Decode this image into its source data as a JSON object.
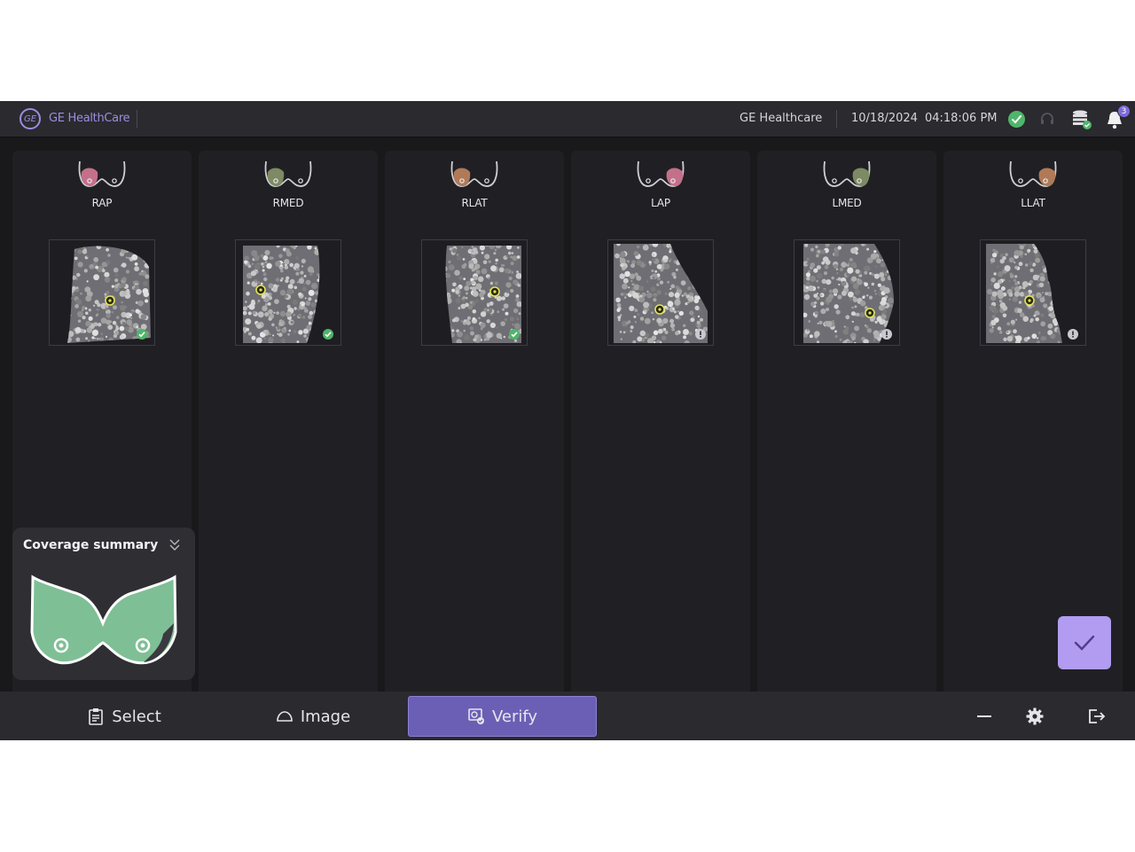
{
  "header": {
    "brand": "GE HealthCare",
    "logo_text": "GE",
    "facility": "GE Healthcare",
    "date": "10/18/2024",
    "time": "04:18:06 PM",
    "notification_count": "3",
    "icons": [
      "check-circle-icon",
      "headset-icon",
      "database-icon",
      "bell-icon"
    ]
  },
  "views": [
    {
      "label": "RAP",
      "side": "right",
      "highlight": "#c4708a",
      "status": "complete"
    },
    {
      "label": "RMED",
      "side": "right",
      "highlight": "#7d8a63",
      "status": "complete"
    },
    {
      "label": "RLAT",
      "side": "right",
      "highlight": "#b07a58",
      "status": "complete"
    },
    {
      "label": "LAP",
      "side": "left",
      "highlight": "#c4708a",
      "status": "info"
    },
    {
      "label": "LMED",
      "side": "left",
      "highlight": "#7d8a63",
      "status": "info"
    },
    {
      "label": "LLAT",
      "side": "left",
      "highlight": "#b07a58",
      "status": "info"
    }
  ],
  "coverage": {
    "title": "Coverage summary",
    "fill_color": "#7fbf95",
    "gap_color": "#3a3a40"
  },
  "bottom_nav": {
    "select_label": "Select",
    "image_label": "Image",
    "verify_label": "Verify",
    "active": "Verify"
  },
  "tools": [
    "minimize-icon",
    "gear-icon",
    "logout-icon"
  ],
  "colors": {
    "accent": "#6b5fb5",
    "accent_light": "#b29cf2",
    "ok": "#4fb56a",
    "background": "#19191c"
  }
}
